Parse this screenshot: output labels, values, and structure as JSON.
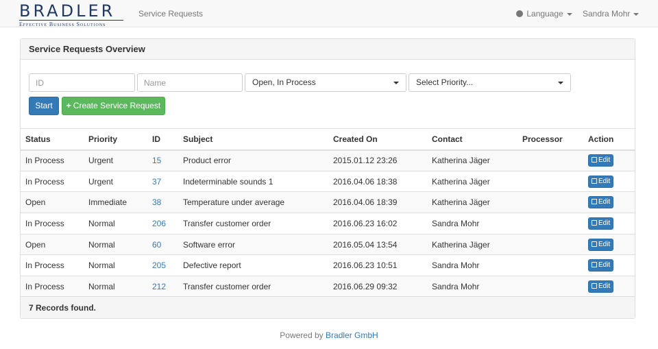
{
  "brand": {
    "name": "BRADLER",
    "tagline": "Effective Business Solutions",
    "color": "#1f3a64"
  },
  "navbar": {
    "service_requests": "Service Requests",
    "language": "Language",
    "user": "Sandra Mohr",
    "language_icon": "globe-icon"
  },
  "panel": {
    "title": "Service Requests Overview",
    "footer": "7 Records found."
  },
  "filters": {
    "id_placeholder": "ID",
    "name_placeholder": "Name",
    "status_value": "Open, In Process",
    "priority_value": "Select Priority..."
  },
  "buttons": {
    "start": "Start",
    "create": "Create Service Request",
    "edit": "Edit"
  },
  "table": {
    "headers": {
      "status": "Status",
      "priority": "Priority",
      "id": "ID",
      "subject": "Subject",
      "created_on": "Created On",
      "contact": "Contact",
      "processor": "Processor",
      "action": "Action"
    },
    "rows": [
      {
        "status": "In Process",
        "priority": "Urgent",
        "id": "15",
        "subject": "Product error",
        "created_on": "2015.01.12 23:26",
        "contact": "Katherina Jäger",
        "processor": ""
      },
      {
        "status": "In Process",
        "priority": "Urgent",
        "id": "37",
        "subject": "Indeterminable sounds 1",
        "created_on": "2016.04.06 18:38",
        "contact": "Katherina Jäger",
        "processor": ""
      },
      {
        "status": "Open",
        "priority": "Immediate",
        "id": "38",
        "subject": "Temperature under average",
        "created_on": "2016.04.06 18:39",
        "contact": "Katherina Jäger",
        "processor": ""
      },
      {
        "status": "In Process",
        "priority": "Normal",
        "id": "206",
        "subject": "Transfer customer order",
        "created_on": "2016.06.23 16:02",
        "contact": "Sandra Mohr",
        "processor": ""
      },
      {
        "status": "Open",
        "priority": "Normal",
        "id": "60",
        "subject": "Software error",
        "created_on": "2016.05.04 13:54",
        "contact": "Katherina Jäger",
        "processor": ""
      },
      {
        "status": "In Process",
        "priority": "Normal",
        "id": "205",
        "subject": "Defective report",
        "created_on": "2016.06.23 10:51",
        "contact": "Sandra Mohr",
        "processor": ""
      },
      {
        "status": "In Process",
        "priority": "Normal",
        "id": "212",
        "subject": "Transfer customer order",
        "created_on": "2016.06.29 09:32",
        "contact": "Sandra Mohr",
        "processor": ""
      }
    ]
  },
  "footer": {
    "prefix": "Powered by",
    "link": "Bradler GmbH"
  },
  "colors": {
    "primary": "#337ab7",
    "success": "#5cb85c",
    "navbar_bg": "#f8f8f8"
  }
}
